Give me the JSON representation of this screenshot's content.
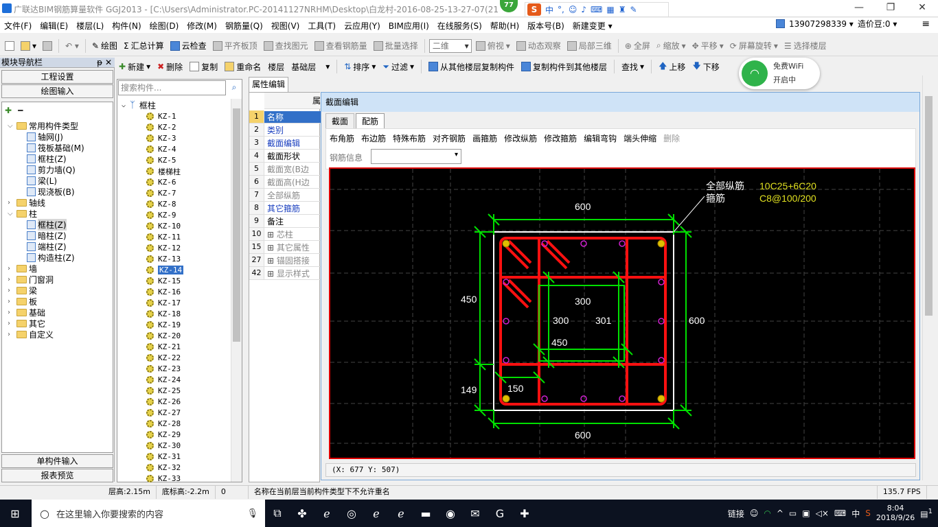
{
  "window": {
    "title": "广联达BIM钢筋算量软件 GGJ2013 - [C:\\Users\\Administrator.PC-20141127NRHM\\Desktop\\白龙村-2016-08-25-13-27-07(21",
    "badge": "77",
    "ime": {
      "mode": "中"
    },
    "min": "—",
    "max": "❐",
    "close": "✕"
  },
  "menu": [
    "文件(F)",
    "编辑(E)",
    "楼层(L)",
    "构件(N)",
    "绘图(D)",
    "修改(M)",
    "钢筋量(Q)",
    "视图(V)",
    "工具(T)",
    "云应用(Y)",
    "BIM应用(I)",
    "在线服务(S)",
    "帮助(H)",
    "版本号(B)",
    "新建变更 ▾"
  ],
  "user": {
    "phone": "13907298339 ▾",
    "price": "造价豆:0 ▾",
    "menu_icon": "≡"
  },
  "toolbar1": {
    "draw": "绘图",
    "sum": "汇总计算",
    "cloud_check": "云检查",
    "flat_top": "平齐板顶",
    "find": "查找图元",
    "view_rebar": "查看钢筋量",
    "batch": "批量选择",
    "view2d": "二维",
    "top_view": "俯视",
    "dyn": "动态观察",
    "local3d": "局部三维",
    "full": "全屏",
    "zoom": "缩放",
    "pan": "平移",
    "rotate": "屏幕旋转",
    "select_floor": "选择楼层"
  },
  "toolbar2": {
    "new": "新建",
    "delete": "删除",
    "copy": "复制",
    "rename": "重命名",
    "floor_label": "楼层",
    "floor": "基础层",
    "sort": "排序",
    "filter": "过滤",
    "copy_from": "从其他楼层复制构件",
    "copy_to": "复制构件到其他楼层",
    "find": "查找",
    "up": "上移",
    "down": "下移"
  },
  "nav": {
    "header": "模块导航栏",
    "pin": "ᵽ ✕",
    "btn_project": "工程设置",
    "btn_draw": "绘图输入",
    "btn_single": "单构件输入",
    "btn_report": "报表预览",
    "tree": [
      {
        "label": "常用构件类型",
        "level": 0,
        "open": true,
        "folder": true
      },
      {
        "label": "轴网(J)",
        "level": 1
      },
      {
        "label": "筏板基础(M)",
        "level": 1
      },
      {
        "label": "框柱(Z)",
        "level": 1
      },
      {
        "label": "剪力墙(Q)",
        "level": 1
      },
      {
        "label": "梁(L)",
        "level": 1
      },
      {
        "label": "现浇板(B)",
        "level": 1
      },
      {
        "label": "轴线",
        "level": 0,
        "folder": true
      },
      {
        "label": "柱",
        "level": 0,
        "open": true,
        "folder": true
      },
      {
        "label": "框柱(Z)",
        "level": 1,
        "selected": true
      },
      {
        "label": "暗柱(Z)",
        "level": 1
      },
      {
        "label": "端柱(Z)",
        "level": 1
      },
      {
        "label": "构造柱(Z)",
        "level": 1
      },
      {
        "label": "墙",
        "level": 0,
        "folder": true
      },
      {
        "label": "门窗洞",
        "level": 0,
        "folder": true
      },
      {
        "label": "梁",
        "level": 0,
        "folder": true
      },
      {
        "label": "板",
        "level": 0,
        "folder": true
      },
      {
        "label": "基础",
        "level": 0,
        "folder": true
      },
      {
        "label": "其它",
        "level": 0,
        "folder": true
      },
      {
        "label": "自定义",
        "level": 0,
        "folder": true
      }
    ]
  },
  "list": {
    "search_placeholder": "搜索构件...",
    "root": "框柱",
    "items": [
      "KZ-1",
      "KZ-2",
      "KZ-3",
      "KZ-4",
      "KZ-5",
      "楼梯柱",
      "KZ-6",
      "KZ-7",
      "KZ-8",
      "KZ-9",
      "KZ-10",
      "KZ-11",
      "KZ-12",
      "KZ-13",
      "KZ-14",
      "KZ-15",
      "KZ-16",
      "KZ-17",
      "KZ-18",
      "KZ-19",
      "KZ-20",
      "KZ-21",
      "KZ-22",
      "KZ-23",
      "KZ-24",
      "KZ-25",
      "KZ-26",
      "KZ-27",
      "KZ-28",
      "KZ-29",
      "KZ-30",
      "KZ-31",
      "KZ-32",
      "KZ-33"
    ],
    "selected": "KZ-14"
  },
  "props": {
    "tab": "属性编辑",
    "header": "属",
    "rows": [
      {
        "n": "1",
        "name": "名称",
        "c": "#fff",
        "bg": "#3270c8"
      },
      {
        "n": "2",
        "name": "类别",
        "c": "#1a3fbf"
      },
      {
        "n": "3",
        "name": "截面编辑",
        "c": "#1a3fbf"
      },
      {
        "n": "4",
        "name": "截面形状",
        "c": "#000"
      },
      {
        "n": "5",
        "name": "截面宽(B边",
        "c": "#888"
      },
      {
        "n": "6",
        "name": "截面高(H边",
        "c": "#888"
      },
      {
        "n": "7",
        "name": "全部纵筋",
        "c": "#888"
      },
      {
        "n": "8",
        "name": "其它箍筋",
        "c": "#1a3fbf"
      },
      {
        "n": "9",
        "name": "备注",
        "c": "#000"
      },
      {
        "n": "10",
        "name": "芯柱",
        "c": "#888",
        "exp": true
      },
      {
        "n": "15",
        "name": "其它属性",
        "c": "#888",
        "exp": true
      },
      {
        "n": "27",
        "name": "锚固搭接",
        "c": "#888",
        "exp": true
      },
      {
        "n": "42",
        "name": "显示样式",
        "c": "#888",
        "exp": true
      }
    ]
  },
  "dialog": {
    "title": "截面编辑",
    "tabs": [
      "截面",
      "配筋"
    ],
    "tools": [
      "布角筋",
      "布边筋",
      "特殊布筋",
      "对齐钢筋",
      "画箍筋",
      "修改纵筋",
      "修改箍筋",
      "编辑弯钩",
      "端头伸缩"
    ],
    "tool_disabled": "删除",
    "rebar_info": "钢筋信息",
    "status": "(X: 677 Y: 507)",
    "drawing": {
      "label_long": "全部纵筋",
      "label_stir": "箍筋",
      "long_val": "10C25+6C20",
      "stir_val": "C8@100/200",
      "dims": {
        "top": "600",
        "bottom": "600",
        "right": "600",
        "left_upper": "450",
        "left_lower": "149",
        "inner_300a": "300",
        "inner_300b": "300",
        "inner_301": "301",
        "inner_450": "450",
        "inner_150": "150"
      }
    }
  },
  "wifi": {
    "line1": "免费WiFi",
    "line2": "开启中",
    "icon": "wifi-icon"
  },
  "status": {
    "floor_h": "层高:2.15m",
    "bottom_h": "底标高:-2.2m",
    "zero": "0",
    "msg": "名称在当前层当前构件类型下不允许重名",
    "fps": "135.7 FPS"
  },
  "taskbar": {
    "search": "在这里输入你要搜索的内容",
    "link": "链接",
    "ime": "中",
    "time": "8:04",
    "date": "2018/9/26",
    "notif": "1"
  }
}
